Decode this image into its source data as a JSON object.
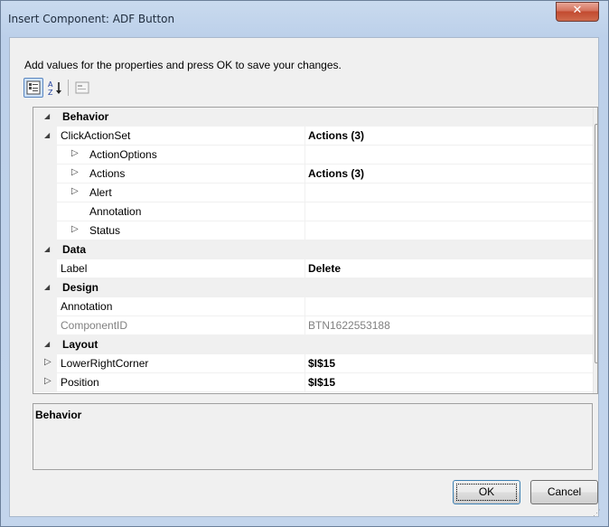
{
  "window": {
    "title": "Insert Component: ADF Button",
    "close_glyph": "✕"
  },
  "instructions": "Add values for the properties and press OK to save your changes.",
  "toolbar": {
    "categorized": "categorized-icon",
    "alphabetical": "sort-az-icon",
    "property_pages": "property-pages-icon"
  },
  "grid": {
    "rows": [
      {
        "kind": "cat",
        "expander": "◢",
        "name": "Behavior",
        "value": ""
      },
      {
        "kind": "prop",
        "expander": "◢",
        "name": "ClickActionSet",
        "value": "Actions (3)",
        "bold_value": true
      },
      {
        "kind": "sub",
        "expander": "▷",
        "name": "ActionOptions",
        "value": ""
      },
      {
        "kind": "sub",
        "expander": "▷",
        "name": "Actions",
        "value": "Actions (3)",
        "bold_value": true
      },
      {
        "kind": "sub",
        "expander": "▷",
        "name": "Alert",
        "value": ""
      },
      {
        "kind": "sub",
        "expander": "",
        "name": "Annotation",
        "value": ""
      },
      {
        "kind": "sub",
        "expander": "▷",
        "name": "Status",
        "value": ""
      },
      {
        "kind": "cat",
        "expander": "◢",
        "name": "Data",
        "value": ""
      },
      {
        "kind": "prop",
        "expander": "",
        "name": "Label",
        "value": "Delete",
        "bold_value": true
      },
      {
        "kind": "cat",
        "expander": "◢",
        "name": "Design",
        "value": ""
      },
      {
        "kind": "prop",
        "expander": "",
        "name": "Annotation",
        "value": ""
      },
      {
        "kind": "prop-dim",
        "expander": "",
        "name": "ComponentID",
        "value": "BTN1622553188"
      },
      {
        "kind": "cat",
        "expander": "◢",
        "name": "Layout",
        "value": ""
      },
      {
        "kind": "prop",
        "expander": "▷",
        "name": "LowerRightCorner",
        "value": "$I$15",
        "bold_value": true
      },
      {
        "kind": "prop",
        "expander": "▷",
        "name": "Position",
        "value": "$I$15",
        "bold_value": true
      }
    ]
  },
  "description": {
    "title": "Behavior"
  },
  "buttons": {
    "ok": "OK",
    "cancel": "Cancel"
  },
  "colors": {
    "category_bg": "#f0f0f0",
    "close_red": "#c24a30",
    "selected_tool": "#cfe2f8"
  }
}
